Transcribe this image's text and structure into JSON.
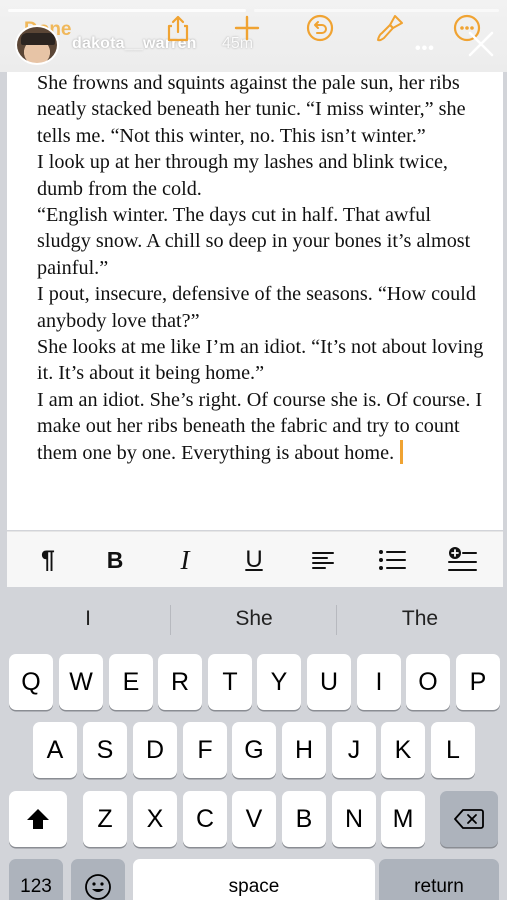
{
  "story": {
    "done_label": "Done",
    "username": "dakota__warren",
    "time_ago": "45m",
    "more_label": "•••"
  },
  "document": {
    "paragraphs": [
      "She frowns and squints against the pale sun, her ribs neatly stacked beneath her tunic. “I miss winter,” she tells me. “Not this winter, no. This isn’t winter.”",
      "I look up at her through my lashes and blink twice, dumb from the cold.",
      "“English winter. The days cut in half. That awful sludgy snow. A chill so deep in your bones it’s almost painful.”",
      "I pout, insecure, defensive of the seasons. “How could anybody love that?”",
      "She looks at me like I’m an idiot. “It’s not about loving it. It’s about it being home.”",
      "I am an idiot. She’s right. Of course she is. Of course. I make out her ribs beneath the fabric and try to count them one by one. Everything is about home."
    ],
    "caret_color": "#f0a332"
  },
  "toolbar": {
    "paragraph": "¶",
    "bold": "B",
    "italic": "I",
    "underline": "U"
  },
  "keyboard": {
    "suggestions": [
      "I",
      "She",
      "The"
    ],
    "row1": [
      "Q",
      "W",
      "E",
      "R",
      "T",
      "Y",
      "U",
      "I",
      "O",
      "P"
    ],
    "row2": [
      "A",
      "S",
      "D",
      "F",
      "G",
      "H",
      "J",
      "K",
      "L"
    ],
    "row3": [
      "Z",
      "X",
      "C",
      "V",
      "B",
      "N",
      "M"
    ],
    "numbers_label": "123",
    "space_label": "space",
    "return_label": "return"
  }
}
